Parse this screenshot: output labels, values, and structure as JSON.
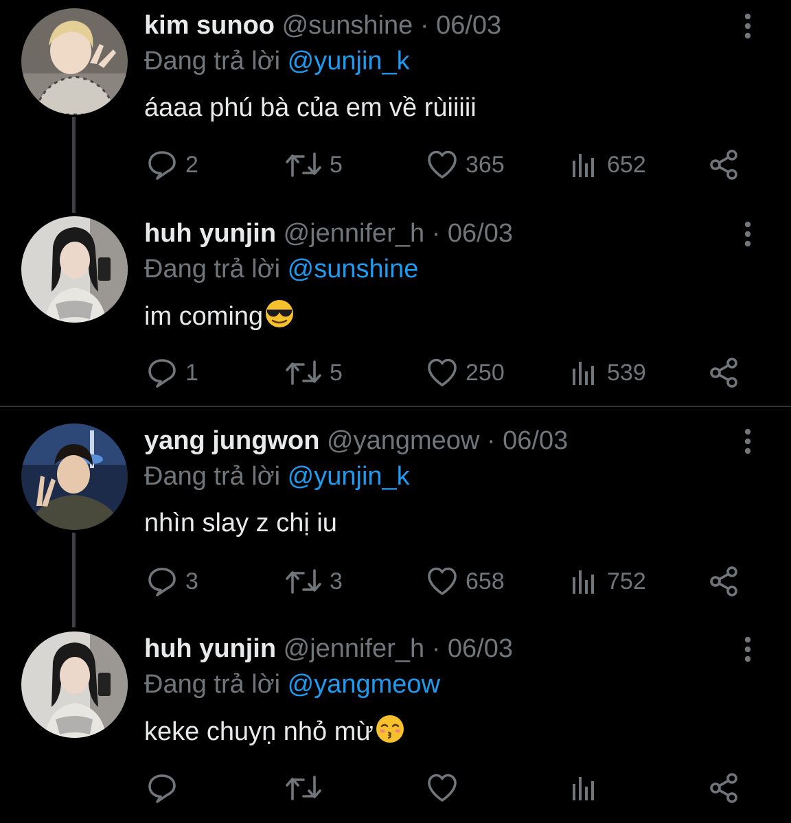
{
  "tweets": [
    {
      "display_name": "kim sunoo",
      "handle": "@sunshine",
      "separator": "·",
      "date": "06/03",
      "replying_to_prefix": "Đang trả lời",
      "replying_to": "@yunjin_k",
      "text": "áaaa phú bà của em về rùiiiii",
      "emoji": "",
      "stats": {
        "replies": "2",
        "retweets": "5",
        "likes": "365",
        "views": "652"
      },
      "avatar_color": "#a9a29a"
    },
    {
      "display_name": "huh yunjin",
      "handle": "@jennifer_h",
      "separator": "·",
      "date": "06/03",
      "replying_to_prefix": "Đang trả lời",
      "replying_to": "@sunshine",
      "text": "im coming",
      "emoji": "sunglasses-emoji",
      "stats": {
        "replies": "1",
        "retweets": "5",
        "likes": "250",
        "views": "539"
      },
      "avatar_color": "#bdbab4"
    },
    {
      "display_name": "yang jungwon",
      "handle": "@yangmeow",
      "separator": "·",
      "date": "06/03",
      "replying_to_prefix": "Đang trả lời",
      "replying_to": "@yunjin_k",
      "text": "nhìn slay z chị iu",
      "emoji": "",
      "stats": {
        "replies": "3",
        "retweets": "3",
        "likes": "658",
        "views": "752"
      },
      "avatar_color": "#2a3b5e"
    },
    {
      "display_name": "huh yunjin",
      "handle": "@jennifer_h",
      "separator": "·",
      "date": "06/03",
      "replying_to_prefix": "Đang trả lời",
      "replying_to": "@yangmeow",
      "text": "keke chuyṇ nhỏ mừ",
      "emoji": "kissing-emoji",
      "stats": {
        "replies": "",
        "retweets": "",
        "likes": "",
        "views": ""
      },
      "avatar_color": "#bdbab4"
    }
  ],
  "colors": {
    "background": "#000000",
    "text": "#e7e9ea",
    "muted": "#71767b",
    "accent": "#1d9bf0",
    "divider": "#2f3336"
  },
  "icons": [
    "reply-icon",
    "retweet-icon",
    "like-icon",
    "views-icon",
    "share-icon",
    "more-options-icon"
  ]
}
